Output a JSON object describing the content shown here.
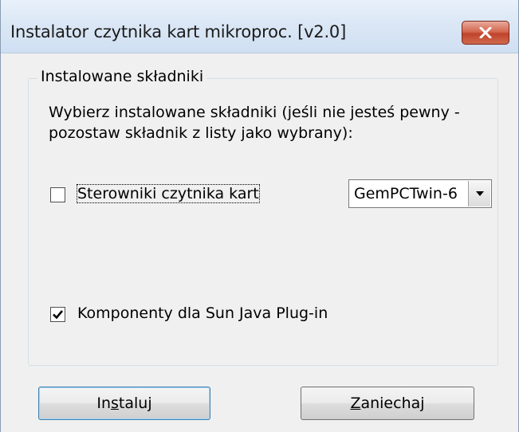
{
  "window": {
    "title": "Instalator czytnika kart mikroproc. [v2.0]",
    "close_icon": "close-icon"
  },
  "group": {
    "legend": "Instalowane składniki",
    "description": "Wybierz instalowane składniki (jeśli nie jesteś pewny - pozostaw składnik z listy jako wybrany):"
  },
  "components": [
    {
      "label": "Sterowniki czytnika kart",
      "checked": false
    },
    {
      "label": "Komponenty dla Sun Java Plug-in",
      "checked": true
    }
  ],
  "driver_select": {
    "value": "GemPCTwin-6"
  },
  "buttons": {
    "install_pre": "In",
    "install_mnemonic": "s",
    "install_post": "taluj",
    "cancel_mnemonic": "Z",
    "cancel_post": "aniechaj"
  },
  "colors": {
    "close_button": "#c9503a",
    "titlebar": "#dbe7f5",
    "face": "#f0f0f0"
  }
}
